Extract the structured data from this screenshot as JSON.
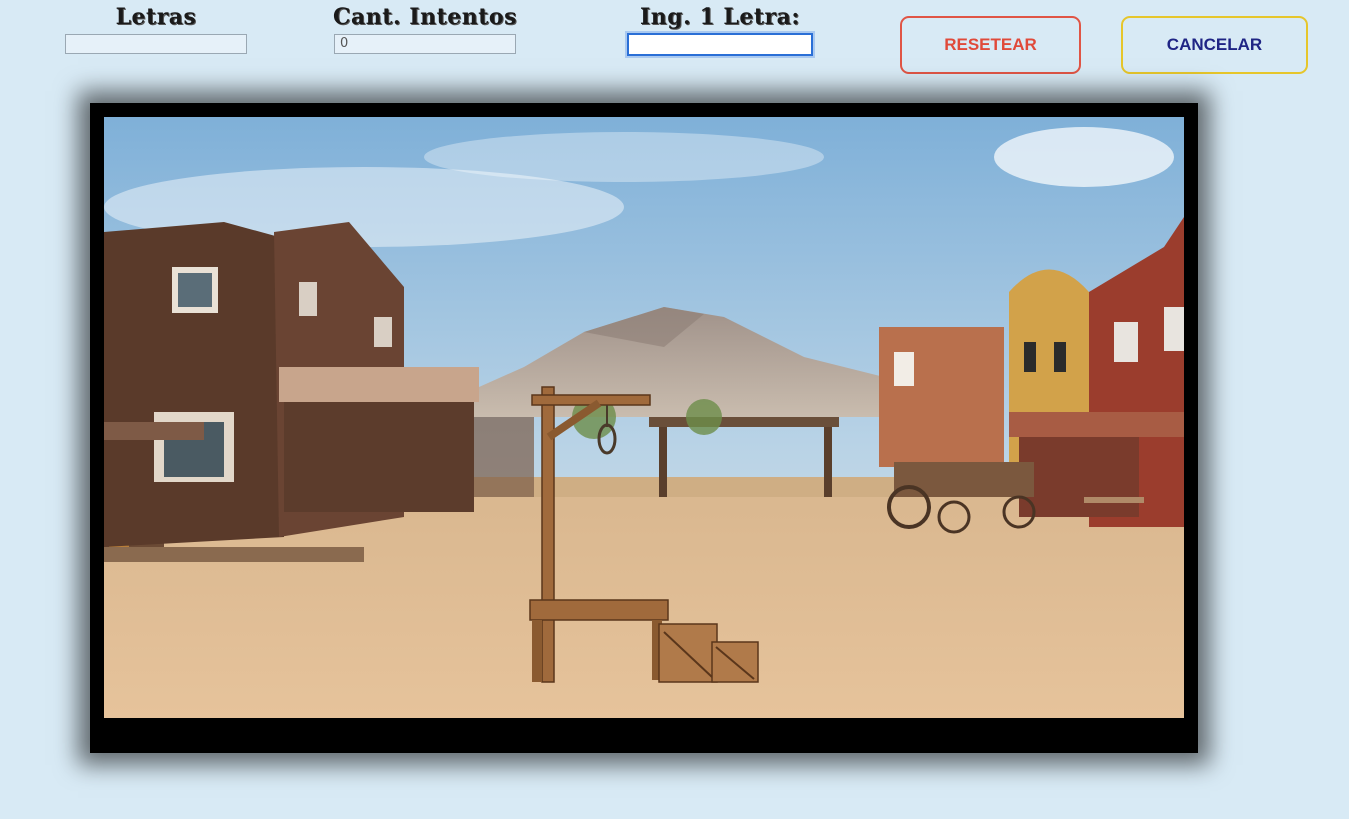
{
  "controls": {
    "letras": {
      "label": "Letras",
      "value": ""
    },
    "intentos": {
      "label": "Cant. Intentos",
      "value": "0"
    },
    "letra": {
      "label": "Ing. 1 Letra:",
      "value": ""
    }
  },
  "buttons": {
    "reset": "RESETEAR",
    "cancel": "CANCELAR"
  },
  "colors": {
    "background": "#d8eaf5",
    "reset_accent": "#e05545",
    "cancel_border": "#e6c62b",
    "cancel_text": "#1f2585"
  },
  "scene": {
    "background": "western-town-street",
    "element": "gallows-icon"
  }
}
